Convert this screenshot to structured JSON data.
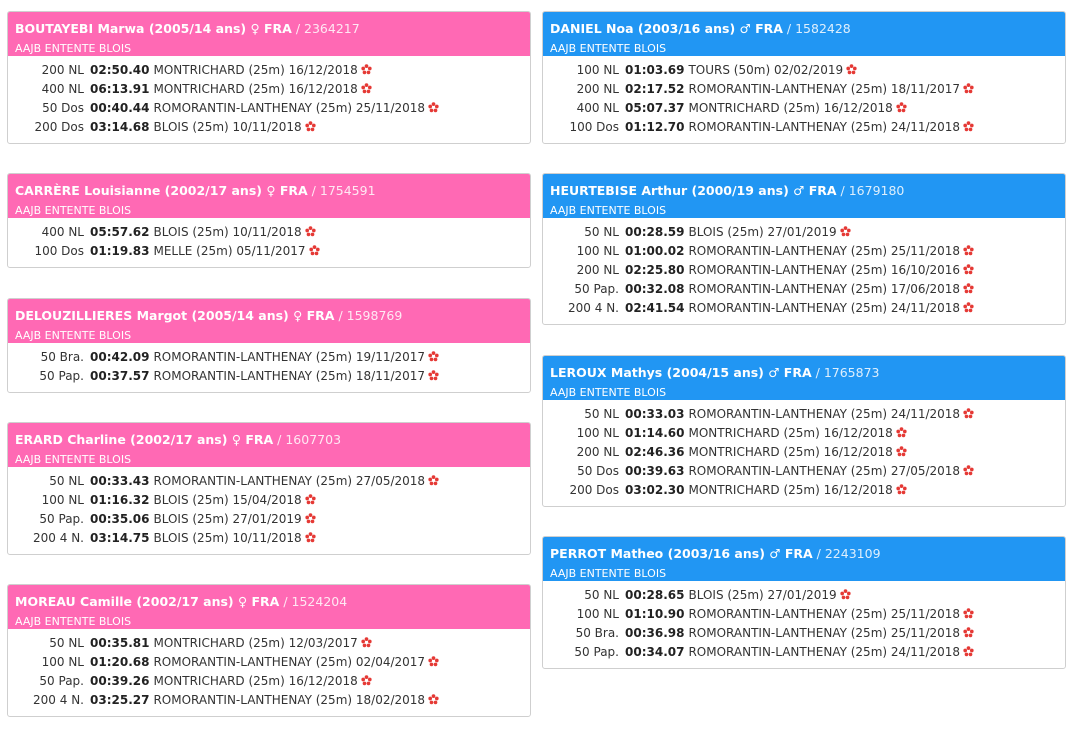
{
  "colors": {
    "female": "#ff69b4",
    "male": "#2196f3",
    "star": "#e53935"
  },
  "left_column": [
    {
      "name": "BOUTAYEBI Marwa (2005/14 ans) ♀ FRA",
      "licence": "2364217",
      "club": "AAJB ENTENTE BLOIS",
      "results": [
        {
          "event": "200 NL",
          "time": "02:50.40",
          "place": "MONTRICHARD (25m)",
          "date": "16/12/2018"
        },
        {
          "event": "400 NL",
          "time": "06:13.91",
          "place": "MONTRICHARD (25m)",
          "date": "16/12/2018"
        },
        {
          "event": "50 Dos",
          "time": "00:40.44",
          "place": "ROMORANTIN-LANTHENAY (25m)",
          "date": "25/11/2018"
        },
        {
          "event": "200 Dos",
          "time": "03:14.68",
          "place": "BLOIS (25m)",
          "date": "10/11/2018"
        }
      ]
    },
    {
      "name": "CARRÈRE Louisianne (2002/17 ans) ♀ FRA",
      "licence": "1754591",
      "club": "AAJB ENTENTE BLOIS",
      "results": [
        {
          "event": "400 NL",
          "time": "05:57.62",
          "place": "BLOIS (25m)",
          "date": "10/11/2018"
        },
        {
          "event": "100 Dos",
          "time": "01:19.83",
          "place": "MELLE (25m)",
          "date": "05/11/2017"
        }
      ]
    },
    {
      "name": "DELOUZILLIERES Margot (2005/14 ans) ♀ FRA",
      "licence": "1598769",
      "club": "AAJB ENTENTE BLOIS",
      "results": [
        {
          "event": "50 Bra.",
          "time": "00:42.09",
          "place": "ROMORANTIN-LANTHENAY (25m)",
          "date": "19/11/2017"
        },
        {
          "event": "50 Pap.",
          "time": "00:37.57",
          "place": "ROMORANTIN-LANTHENAY (25m)",
          "date": "18/11/2017"
        }
      ]
    },
    {
      "name": "ERARD Charline (2002/17 ans) ♀ FRA",
      "licence": "1607703",
      "club": "AAJB ENTENTE BLOIS",
      "results": [
        {
          "event": "50 NL",
          "time": "00:33.43",
          "place": "ROMORANTIN-LANTHENAY (25m)",
          "date": "27/05/2018"
        },
        {
          "event": "100 NL",
          "time": "01:16.32",
          "place": "BLOIS (25m)",
          "date": "15/04/2018"
        },
        {
          "event": "50 Pap.",
          "time": "00:35.06",
          "place": "BLOIS (25m)",
          "date": "27/01/2019"
        },
        {
          "event": "200 4 N.",
          "time": "03:14.75",
          "place": "BLOIS (25m)",
          "date": "10/11/2018"
        }
      ]
    },
    {
      "name": "MOREAU Camille (2002/17 ans) ♀ FRA",
      "licence": "1524204",
      "club": "AAJB ENTENTE BLOIS",
      "results": [
        {
          "event": "50 NL",
          "time": "00:35.81",
          "place": "MONTRICHARD (25m)",
          "date": "12/03/2017"
        },
        {
          "event": "100 NL",
          "time": "01:20.68",
          "place": "ROMORANTIN-LANTHENAY (25m)",
          "date": "02/04/2017"
        },
        {
          "event": "50 Pap.",
          "time": "00:39.26",
          "place": "MONTRICHARD (25m)",
          "date": "16/12/2018"
        },
        {
          "event": "200 4 N.",
          "time": "03:25.27",
          "place": "ROMORANTIN-LANTHENAY (25m)",
          "date": "18/02/2018"
        }
      ]
    }
  ],
  "right_column": [
    {
      "name": "DANIEL Noa (2003/16 ans) ♂ FRA",
      "licence": "1582428",
      "club": "AAJB ENTENTE BLOIS",
      "results": [
        {
          "event": "100 NL",
          "time": "01:03.69",
          "place": "TOURS (50m)",
          "date": "02/02/2019"
        },
        {
          "event": "200 NL",
          "time": "02:17.52",
          "place": "ROMORANTIN-LANTHENAY (25m)",
          "date": "18/11/2017"
        },
        {
          "event": "400 NL",
          "time": "05:07.37",
          "place": "MONTRICHARD (25m)",
          "date": "16/12/2018"
        },
        {
          "event": "100 Dos",
          "time": "01:12.70",
          "place": "ROMORANTIN-LANTHENAY (25m)",
          "date": "24/11/2018"
        }
      ]
    },
    {
      "name": "HEURTEBISE Arthur (2000/19 ans) ♂ FRA",
      "licence": "1679180",
      "club": "AAJB ENTENTE BLOIS",
      "results": [
        {
          "event": "50 NL",
          "time": "00:28.59",
          "place": "BLOIS (25m)",
          "date": "27/01/2019"
        },
        {
          "event": "100 NL",
          "time": "01:00.02",
          "place": "ROMORANTIN-LANTHENAY (25m)",
          "date": "25/11/2018"
        },
        {
          "event": "200 NL",
          "time": "02:25.80",
          "place": "ROMORANTIN-LANTHENAY (25m)",
          "date": "16/10/2016"
        },
        {
          "event": "50 Pap.",
          "time": "00:32.08",
          "place": "ROMORANTIN-LANTHENAY (25m)",
          "date": "17/06/2018"
        },
        {
          "event": "200 4 N.",
          "time": "02:41.54",
          "place": "ROMORANTIN-LANTHENAY (25m)",
          "date": "24/11/2018"
        }
      ]
    },
    {
      "name": "LEROUX Mathys (2004/15 ans) ♂ FRA",
      "licence": "1765873",
      "club": "AAJB ENTENTE BLOIS",
      "results": [
        {
          "event": "50 NL",
          "time": "00:33.03",
          "place": "ROMORANTIN-LANTHENAY (25m)",
          "date": "24/11/2018"
        },
        {
          "event": "100 NL",
          "time": "01:14.60",
          "place": "MONTRICHARD (25m)",
          "date": "16/12/2018"
        },
        {
          "event": "200 NL",
          "time": "02:46.36",
          "place": "MONTRICHARD (25m)",
          "date": "16/12/2018"
        },
        {
          "event": "50 Dos",
          "time": "00:39.63",
          "place": "ROMORANTIN-LANTHENAY (25m)",
          "date": "27/05/2018"
        },
        {
          "event": "200 Dos",
          "time": "03:02.30",
          "place": "MONTRICHARD (25m)",
          "date": "16/12/2018"
        }
      ]
    },
    {
      "name": "PERROT Matheo (2003/16 ans) ♂ FRA",
      "licence": "2243109",
      "club": "AAJB ENTENTE BLOIS",
      "results": [
        {
          "event": "50 NL",
          "time": "00:28.65",
          "place": "BLOIS (25m)",
          "date": "27/01/2019"
        },
        {
          "event": "100 NL",
          "time": "01:10.90",
          "place": "ROMORANTIN-LANTHENAY (25m)",
          "date": "25/11/2018"
        },
        {
          "event": "50 Bra.",
          "time": "00:36.98",
          "place": "ROMORANTIN-LANTHENAY (25m)",
          "date": "25/11/2018"
        },
        {
          "event": "50 Pap.",
          "time": "00:34.07",
          "place": "ROMORANTIN-LANTHENAY (25m)",
          "date": "24/11/2018"
        }
      ]
    }
  ]
}
